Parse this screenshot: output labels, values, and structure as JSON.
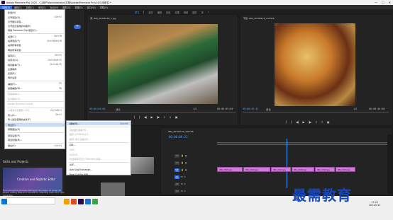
{
  "titlebar": {
    "title": "Adobe Premiere Pro 2020 - C:\\用户\\Administrator\\文档\\Adobe\\Premiere Pro\\14.0\\未命名 *",
    "minimize": "—",
    "maximize": "☐",
    "close": "✕"
  },
  "menubar": {
    "items": [
      "文件(F)",
      "编辑(E)",
      "剪辑(C)",
      "序列(S)",
      "标记(M)",
      "图形(G)",
      "视图(V)",
      "窗口(W)",
      "帮助(H)"
    ]
  },
  "workspace_tabs": [
    "学习",
    "组件",
    "编辑",
    "颜色",
    "效果",
    "音频",
    "图形",
    "库",
    "»"
  ],
  "source_monitor": {
    "tab": "源: IMG_20190129_1.jpg",
    "tc_left": "00:00:00:00",
    "tc_right": "00:00:05:00",
    "fit": "适合",
    "quality": "1/2"
  },
  "program_monitor": {
    "tab": "节目: IMG_20190129_141326",
    "tc_left": "00:00:09:23",
    "tc_right": "00:00:40:00",
    "fit": "适合",
    "quality": "1/2"
  },
  "timeline": {
    "tab": "IMG_20190129_141326",
    "timecode": "00:00:09:23",
    "tracks": [
      "V3",
      "V2",
      "V1",
      "A1",
      "A2",
      "A3"
    ],
    "clips": [
      "IMG_2019.jpg",
      "IMG_2019.jpg",
      "IMG_2019.jpg",
      "IMG_2019.jpg",
      "IMG_2019.jpg",
      "IMG_2019.jpg"
    ]
  },
  "learn": {
    "heading": "Skills and Projects",
    "card_title": "Creative and Stylistic Edits",
    "description": "Five interactive tutorials that teach the basics of using clip speed, adding titles and transitions, adjusting audio and color correction."
  },
  "file_menu": {
    "items": [
      {
        "label": "新建(N)",
        "shortcut": "",
        "state": "normal"
      },
      {
        "label": "打开项目(O)...",
        "shortcut": "Ctrl+O",
        "state": "normal"
      },
      {
        "label": "打开团队项目...",
        "shortcut": "",
        "state": "normal"
      },
      {
        "label": "打开最近使用的内容(E)",
        "shortcut": "",
        "state": "normal"
      },
      {
        "label": "转换 Premiere Clip 项目(C)...",
        "shortcut": "",
        "state": "normal"
      },
      {
        "label": "关闭(C)",
        "shortcut": "Ctrl+W",
        "state": "normal"
      },
      {
        "label": "关闭项目(P)",
        "shortcut": "Ctrl+Shift+W",
        "state": "normal"
      },
      {
        "label": "关闭所有项目",
        "shortcut": "",
        "state": "normal"
      },
      {
        "label": "刷新所有项目",
        "shortcut": "",
        "state": "normal"
      },
      {
        "label": "保存(S)",
        "shortcut": "Ctrl+S",
        "state": "normal"
      },
      {
        "label": "另存为(A)...",
        "shortcut": "Ctrl+Shift+S",
        "state": "normal"
      },
      {
        "label": "保存副本(Y)...",
        "shortcut": "Ctrl+Alt+S",
        "state": "normal"
      },
      {
        "label": "全部保存",
        "shortcut": "",
        "state": "normal"
      },
      {
        "label": "还原(R)",
        "shortcut": "",
        "state": "normal"
      },
      {
        "label": "同步设置",
        "shortcut": "",
        "state": "normal"
      },
      {
        "label": "捕捉(T)...",
        "shortcut": "F5",
        "state": "normal"
      },
      {
        "label": "批量捕捉(B)...",
        "shortcut": "F6",
        "state": "normal"
      },
      {
        "label": "链接媒体(L)...",
        "shortcut": "",
        "state": "disabled"
      },
      {
        "label": "设为脱机(O)...",
        "shortcut": "",
        "state": "disabled"
      },
      {
        "label": "Adobe Dynamic Link(K)",
        "shortcut": "",
        "state": "disabled"
      },
      {
        "label": "从媒体浏览器导入(M)",
        "shortcut": "Ctrl+Alt+I",
        "state": "disabled"
      },
      {
        "label": "导入(I)...",
        "shortcut": "Ctrl+I",
        "state": "normal"
      },
      {
        "label": "导入最近使用的文件(F)",
        "shortcut": "",
        "state": "normal"
      },
      {
        "label": "导出(E)",
        "shortcut": "",
        "state": "highlighted"
      },
      {
        "label": "获取属性(G)",
        "shortcut": "",
        "state": "normal"
      },
      {
        "label": "项目设置(P)",
        "shortcut": "",
        "state": "normal"
      },
      {
        "label": "项目管理(M)...",
        "shortcut": "",
        "state": "normal"
      },
      {
        "label": "退出(X)",
        "shortcut": "Ctrl+Q",
        "state": "normal"
      }
    ]
  },
  "export_submenu": {
    "items": [
      {
        "label": "媒体(M)...",
        "shortcut": "Ctrl+M",
        "state": "highlighted"
      },
      {
        "label": "动态图形模板(R)...",
        "shortcut": "",
        "state": "disabled"
      },
      {
        "label": "磁带 (DV/HDV)(T)...",
        "shortcut": "",
        "state": "disabled"
      },
      {
        "label": "磁带 (串行设备)(S)...",
        "shortcut": "",
        "state": "disabled"
      },
      {
        "label": "EDL...",
        "shortcut": "",
        "state": "normal"
      },
      {
        "label": "OMF...",
        "shortcut": "",
        "state": "disabled"
      },
      {
        "label": "标记(M)...",
        "shortcut": "",
        "state": "disabled"
      },
      {
        "label": "将选择项导出为 Premiere 项目...",
        "shortcut": "",
        "state": "disabled"
      },
      {
        "label": "AAF...",
        "shortcut": "",
        "state": "normal"
      },
      {
        "label": "Avid Log Exchange...",
        "shortcut": "",
        "state": "normal"
      },
      {
        "label": "Final Cut Pro XML...",
        "shortcut": "",
        "state": "normal"
      }
    ]
  },
  "taskbar": {
    "time": "17:20",
    "date": "2021/5/14"
  },
  "watermark": "最需教育",
  "colors": {
    "accent": "#4aa3ff",
    "clip": "#d27ad8",
    "menu_highlight": "#c8dcf4"
  }
}
